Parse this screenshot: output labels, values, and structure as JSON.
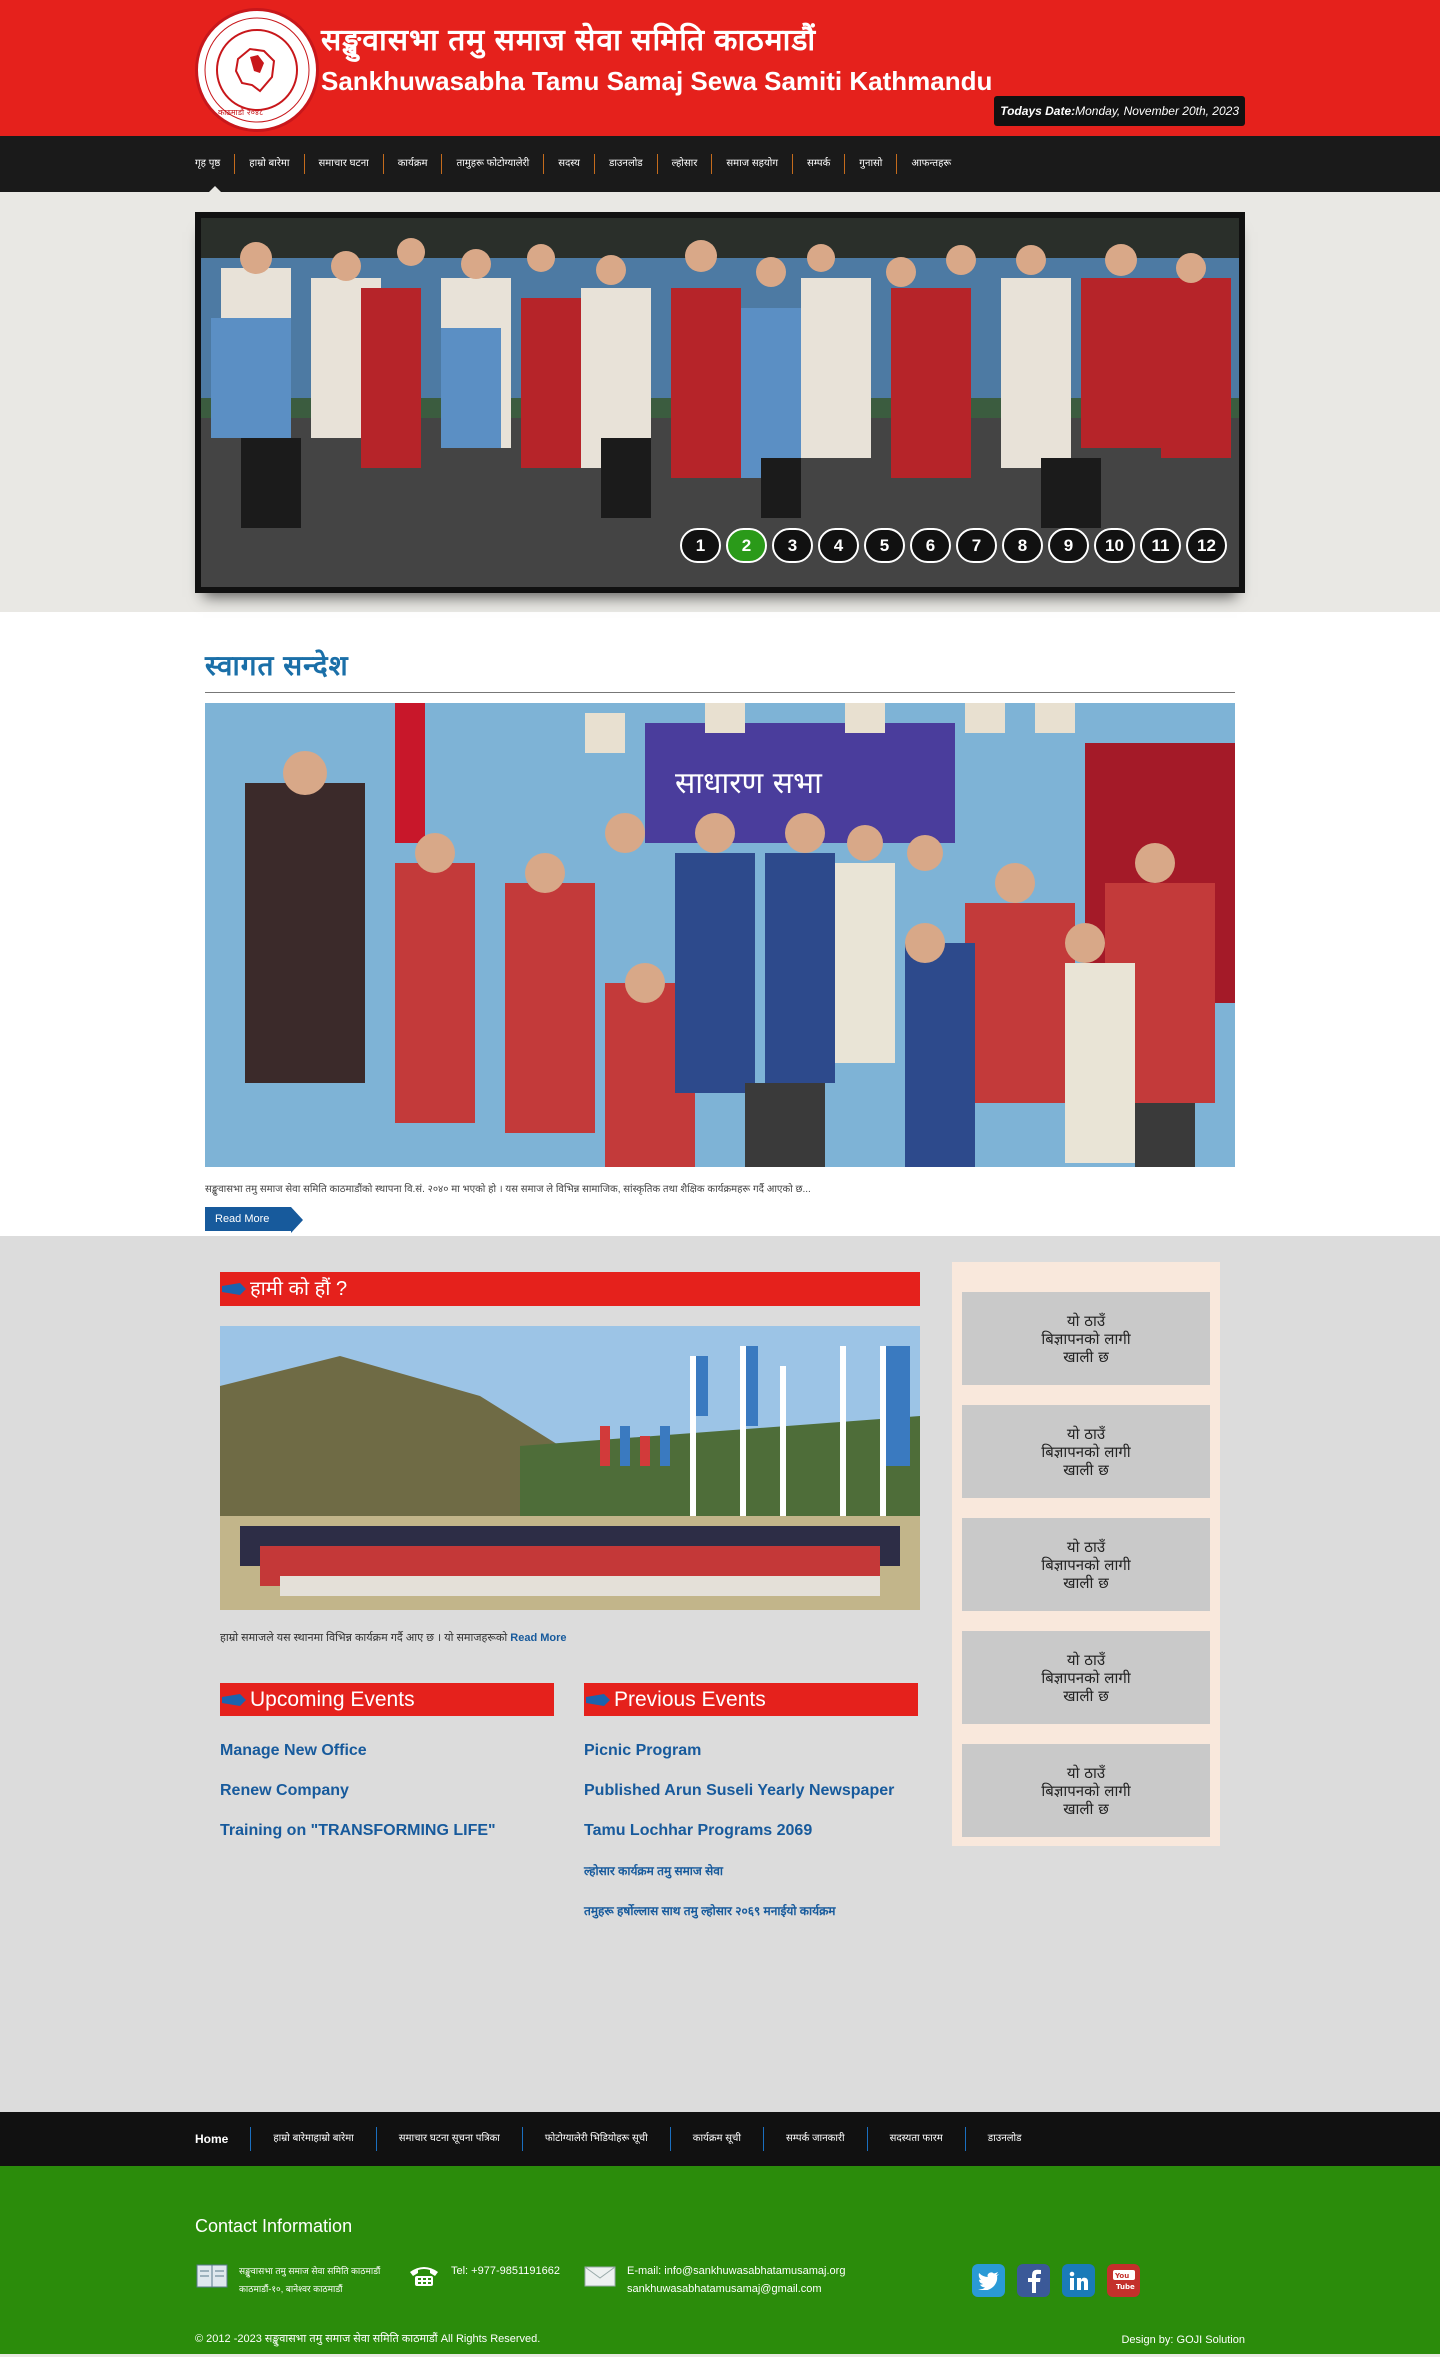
{
  "header": {
    "title_np": "सङ्खुवासभा तमु समाज सेवा समिति काठमाडौं",
    "title_en": "Sankhuwasabha Tamu Samaj Sewa Samiti Kathmandu",
    "date_label": "Todays Date:",
    "date_value": "Monday, November 20th, 2023"
  },
  "nav": {
    "items": [
      {
        "label": "गृह पृष्ठ"
      },
      {
        "label": "हाम्रो बारेमा"
      },
      {
        "label": "समाचार घटना"
      },
      {
        "label": "कार्यक्रम"
      },
      {
        "label": "तामुहरू फोटोग्यालेरी"
      },
      {
        "label": "सदस्य"
      },
      {
        "label": "डाउनलोड"
      },
      {
        "label": "ल्होसार"
      },
      {
        "label": "समाज सहयोग"
      },
      {
        "label": "सम्पर्क"
      },
      {
        "label": "गुनासो"
      },
      {
        "label": "आफन्तहरू"
      }
    ]
  },
  "slider": {
    "pages": [
      "1",
      "2",
      "3",
      "4",
      "5",
      "6",
      "7",
      "8",
      "9",
      "10",
      "11",
      "12"
    ],
    "active_page": "2"
  },
  "welcome": {
    "title": "स्वागत सन्देश",
    "excerpt": "सङ्खुवासभा तमु समाज सेवा समिति काठमाडौंको स्थापना वि.सं. २०४० मा भएको हो । यस समाज ले विभिन्न सामाजिक, सांस्कृतिक तथा शैक्षिक कार्यक्रमहरू गर्दै आएको छ...",
    "read_more": "Read More"
  },
  "who": {
    "title": "हामी को हौं ?",
    "excerpt": "हाम्रो समाजले यस स्थानमा विभिन्न कार्यक्रम गर्दै आए छ । यो समाजहरूको",
    "read_more": "Read More"
  },
  "upcoming": {
    "title": "Upcoming Events",
    "items": [
      {
        "label": "Manage New Office"
      },
      {
        "label": "Renew Company"
      },
      {
        "label": "Training on \"TRANSFORMING LIFE\""
      }
    ]
  },
  "previous": {
    "title": "Previous Events",
    "items": [
      {
        "label": "Picnic Program"
      },
      {
        "label": "Published Arun Suseli Yearly Newspaper"
      },
      {
        "label": "Tamu Lochhar Programs 2069"
      },
      {
        "label": "ल्होसार कार्यक्रम तमु समाज सेवा"
      },
      {
        "label": "तमुहरू हर्षोल्लास साथ तमु ल्होसार २०६९ मनाईयो कार्यक्रम"
      }
    ]
  },
  "ads": {
    "text_line1": "यो ठाउँ",
    "text_line2": "बिज्ञापनको लागी",
    "text_line3": "खाली छ"
  },
  "footnav": {
    "items": [
      {
        "label": "Home"
      },
      {
        "label": "हाम्रो बारेमाहाम्रो बारेमा"
      },
      {
        "label": "समाचार घटना सूचना पत्रिका"
      },
      {
        "label": "फोटोग्यालेरी भिडियोहरू सूची"
      },
      {
        "label": "कार्यक्रम सूची"
      },
      {
        "label": "सम्पर्क जानकारी"
      },
      {
        "label": "सदस्यता फारम"
      },
      {
        "label": "डाउनलोड"
      }
    ]
  },
  "footer": {
    "contact_title": "Contact Information",
    "address_line1": "सङ्खुवासभा तमु समाज सेवा समिति काठमाडौं",
    "address_line2": "काठमाडौं-१०, बानेश्वर काठमाडौं",
    "tel": "Tel: +977-9851191662",
    "email_line1": "E-mail: info@sankhuwasabhatamusamaj.org",
    "email_line2": "sankhuwasabhatamusamaj@gmail.com",
    "copyright": "© 2012 -2023 सङ्खुवासभा तमु समाज सेवा समिति काठमाडौं All Rights Reserved.",
    "design": "Design by: GOJI Solution",
    "social": [
      "twitter-icon",
      "facebook-icon",
      "linkedin-icon",
      "youtube-icon"
    ]
  },
  "colors": {
    "header_red": "#e5211c",
    "nav_dark": "#1a1a1a",
    "footer_green": "#2b8c0b",
    "link_blue": "#175a9c",
    "pager_active": "#2a9a19"
  }
}
